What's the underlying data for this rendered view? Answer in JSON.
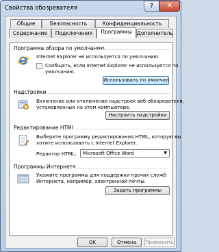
{
  "window": {
    "title": "Свойства обозревателя",
    "help_label": "?",
    "close_label": "✕"
  },
  "tabs": [
    {
      "label": "Общие"
    },
    {
      "label": "Безопасность"
    },
    {
      "label": "Конфиденциальность"
    },
    {
      "label": "Содержание"
    },
    {
      "label": "Подключения"
    },
    {
      "label": "Программы",
      "active": true
    },
    {
      "label": "Дополнительно"
    }
  ],
  "default_browser": {
    "title": "Программа обзора по умолчанию",
    "status": "Internet Explorer не используется по умолчанию.",
    "checkbox_line1": "Сообщать, если Internet Explorer не используется по",
    "checkbox_line2": "умолчанию.",
    "checkbox_checked": false,
    "button": "Использовать по умолчанию"
  },
  "addons": {
    "title": "Надстройки",
    "line1": "Включение или отключение надстроек веб-обозревателя,",
    "line2": "установленных на этом компьютере.",
    "button": "Настроить надстройки"
  },
  "html_editing": {
    "title": "Редактирование HTML",
    "line1": "Выберите программу редактирования HTML, которую вы",
    "line2": "хотите использовать с Internet Explorer.",
    "editor_label": "Редактор HTML:",
    "editor_value": "Microsoft Office Word"
  },
  "internet_programs": {
    "title": "Программы Интернета",
    "line1": "Укажите программы для поддержки прочих служб",
    "line2": "Интернета, например, электронной почты.",
    "button": "Задать программы"
  },
  "footer": {
    "ok": "OK",
    "cancel": "Отмена",
    "apply": "Применить"
  },
  "icons": [
    "internet-explorer-icon",
    "addons-icon",
    "html-editor-icon",
    "internet-programs-icon"
  ],
  "colors": {
    "title_bar": "#c8d8ec",
    "close_button": "#c44a33",
    "focus_border": "#3c7fb1",
    "ie_blue": "#1f74d6",
    "ie_ring": "#f3b92a"
  }
}
